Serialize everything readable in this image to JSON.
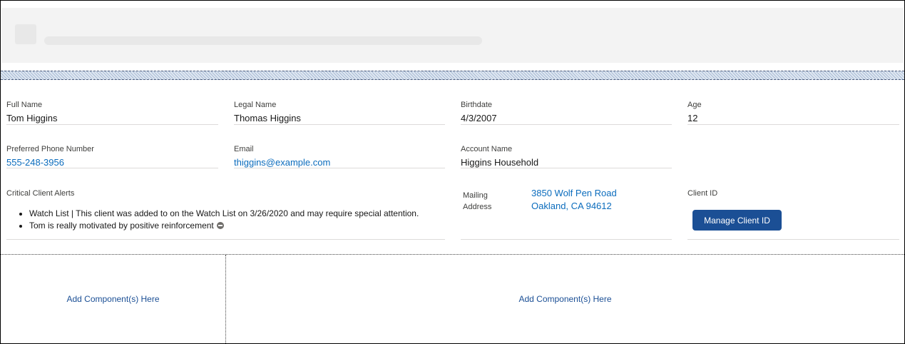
{
  "fields": {
    "full_name": {
      "label": "Full Name",
      "value": "Tom Higgins"
    },
    "legal_name": {
      "label": "Legal Name",
      "value": "Thomas Higgins"
    },
    "birthdate": {
      "label": "Birthdate",
      "value": "4/3/2007"
    },
    "age": {
      "label": "Age",
      "value": "12"
    },
    "phone": {
      "label": "Preferred Phone Number",
      "value": "555-248-3956"
    },
    "email": {
      "label": "Email",
      "value": "thiggins@example.com"
    },
    "account": {
      "label": "Account Name",
      "value": "Higgins Household"
    }
  },
  "alerts": {
    "label": "Critical Client Alerts",
    "items": [
      "Watch List | This client was added to on the Watch List on 3/26/2020 and may require special attention.",
      "Tom is really motivated by positive reinforcement"
    ]
  },
  "mailing": {
    "label_line1": "Mailing",
    "label_line2": "Address",
    "line1": "3850 Wolf Pen Road",
    "line2": "Oakland, CA 94612"
  },
  "client_id": {
    "label": "Client ID",
    "button_label": "Manage Client ID"
  },
  "regions": {
    "left_label": "Add Component(s) Here",
    "right_label": "Add Component(s) Here"
  },
  "colors": {
    "link": "#0b6cbd",
    "button": "#1b4f95"
  }
}
